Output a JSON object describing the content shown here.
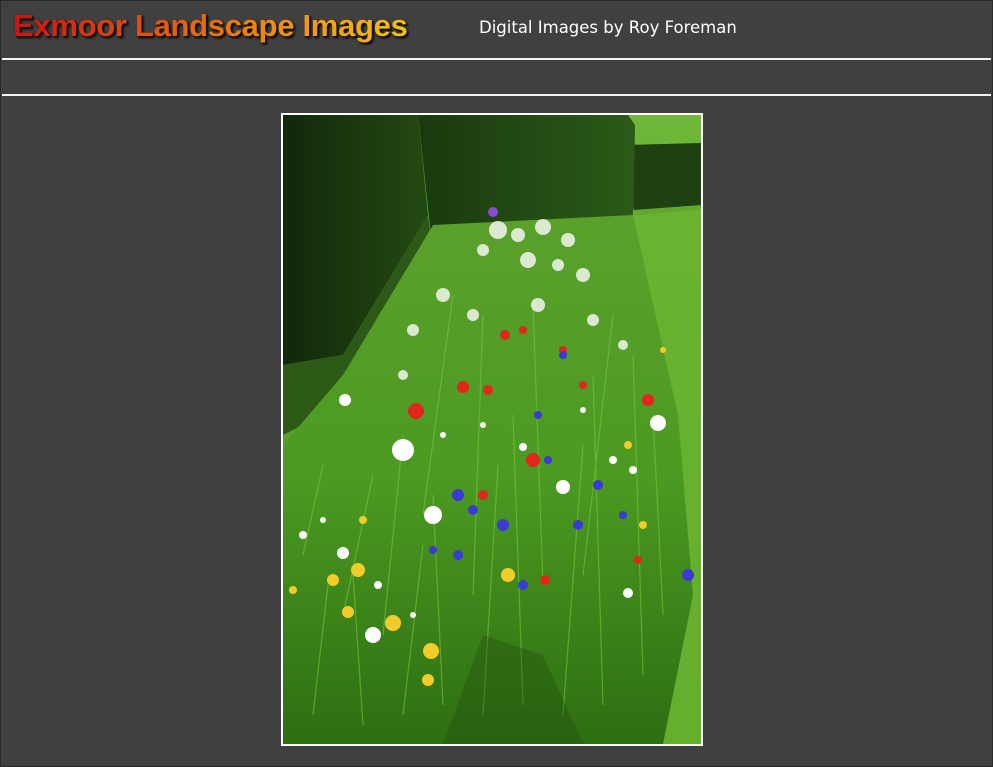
{
  "header": {
    "title": "Exmoor Landscape Images",
    "subtitle": "Digital Images by Roy Foreman"
  },
  "image": {
    "subject-icon": "wildflower-meadow-photo",
    "colors": {
      "hedge": "#1c3c10",
      "grass": "#5aa52a",
      "poppy": "#e2261a",
      "cornflower": "#3a3ad6",
      "daisy": "#ffffff",
      "marigold": "#f2cc2a"
    }
  },
  "colors": {
    "background": "#404040",
    "rule": "#f4f4f4",
    "subtitle": "#ffffff"
  }
}
